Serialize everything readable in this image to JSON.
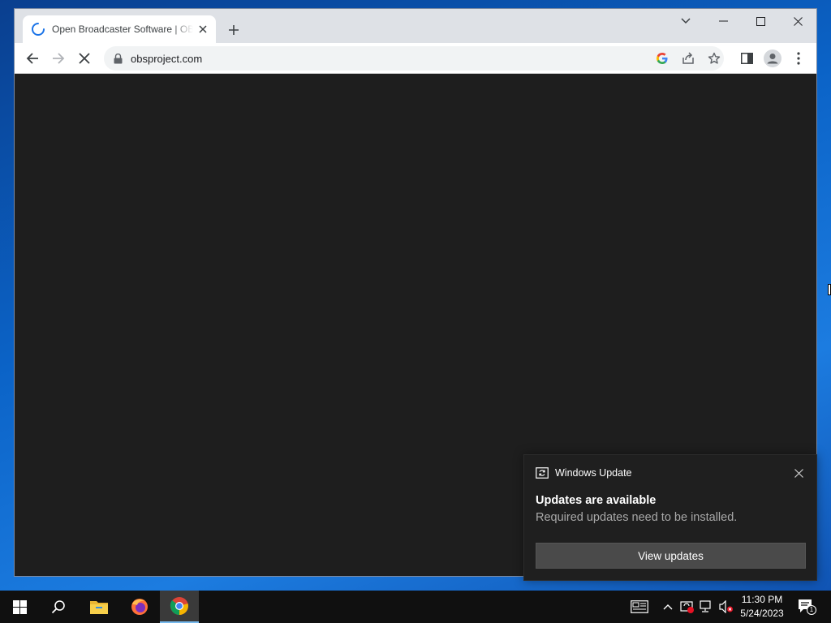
{
  "browser": {
    "tab": {
      "title": "Open Broadcaster Software | OBS"
    },
    "address": {
      "url": "obsproject.com"
    }
  },
  "notification": {
    "app_name": "Windows Update",
    "title": "Updates are available",
    "body": "Required updates need to be installed.",
    "button_label": "View updates"
  },
  "taskbar": {
    "time": "11:30 PM",
    "date": "5/24/2023",
    "notification_count": "1",
    "pinned": [
      "start-icon",
      "search-icon",
      "file-explorer-icon",
      "firefox-icon",
      "chrome-icon"
    ]
  },
  "colors": {
    "taskbar": "#101010",
    "viewport": "#1e1e1e",
    "toast": "#1f1f1f",
    "accent": "#76b9ed"
  }
}
